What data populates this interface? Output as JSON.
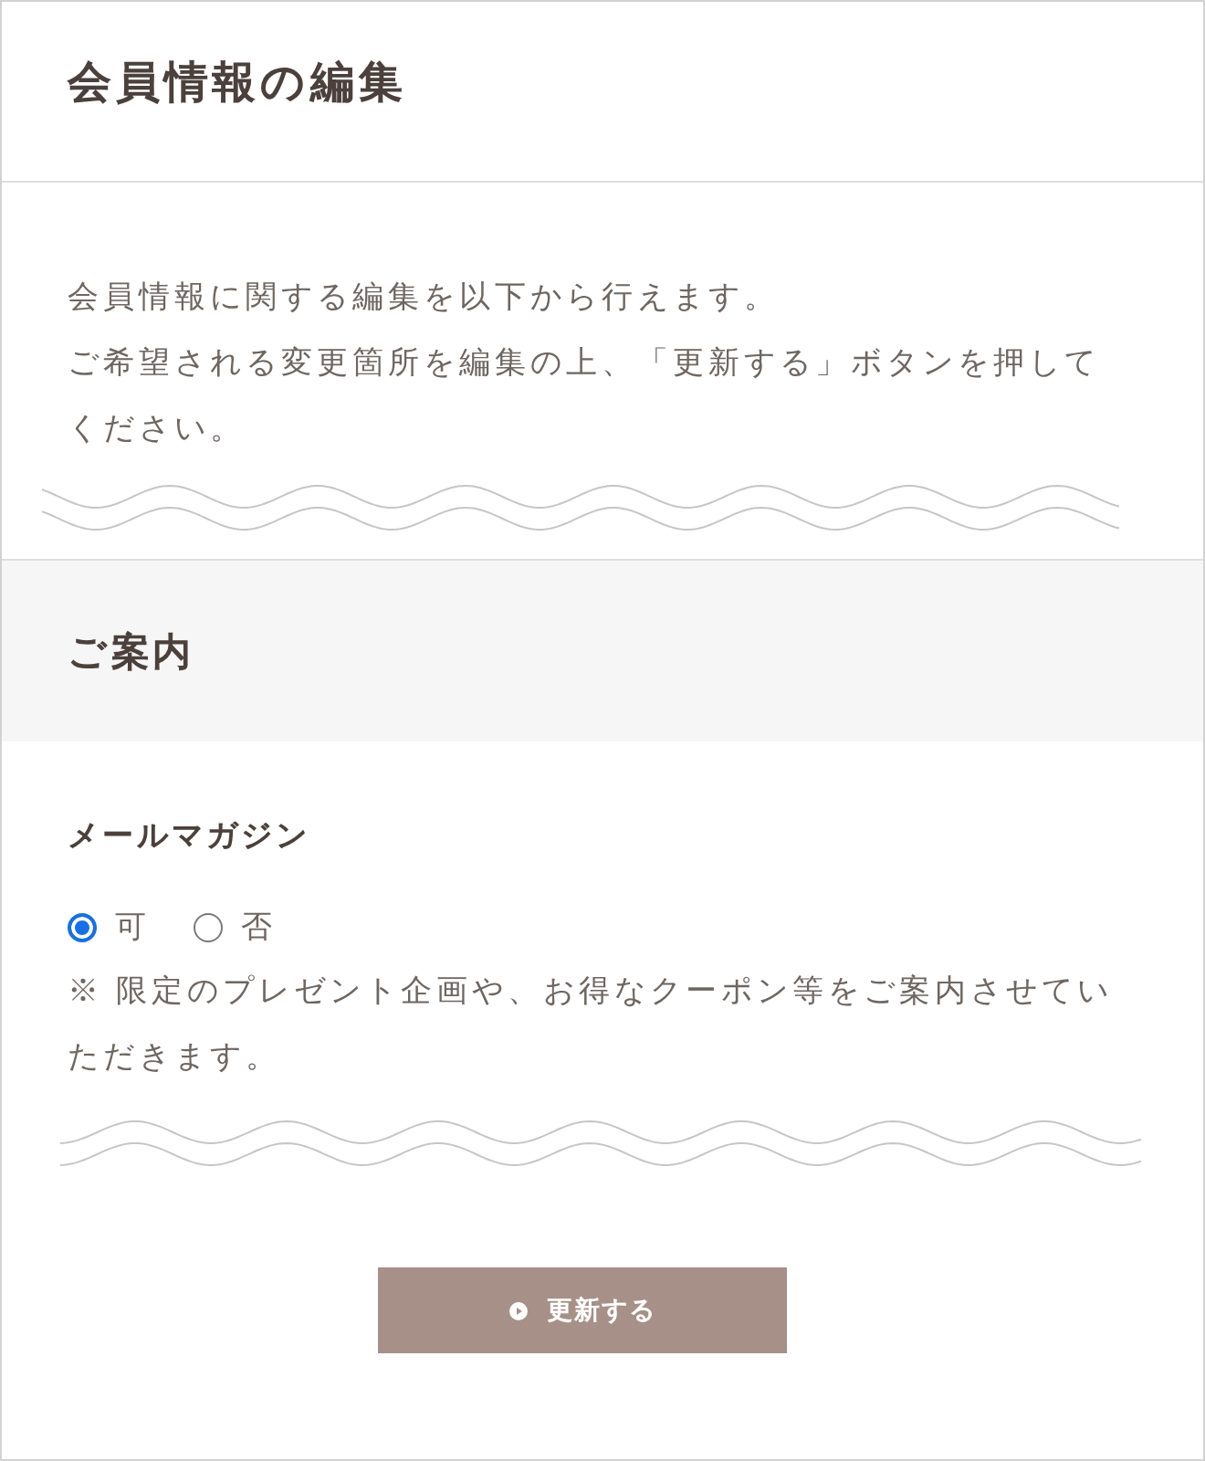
{
  "page_title": "会員情報の編集",
  "intro": {
    "lines": [
      "会員情報に関する編集を以下から行えます。",
      "ご希望される変更箇所を編集の上、「更新する」ボタンを押してください。"
    ]
  },
  "section": {
    "heading": "ご案内"
  },
  "mail_magazine": {
    "label": "メールマガジン",
    "options": [
      {
        "label": "可",
        "selected": true
      },
      {
        "label": "否",
        "selected": false
      }
    ],
    "note": "※ 限定のプレゼント企画や、お得なクーポン等をご案内させていただきます。"
  },
  "submit_button": {
    "label": "更新する"
  }
}
